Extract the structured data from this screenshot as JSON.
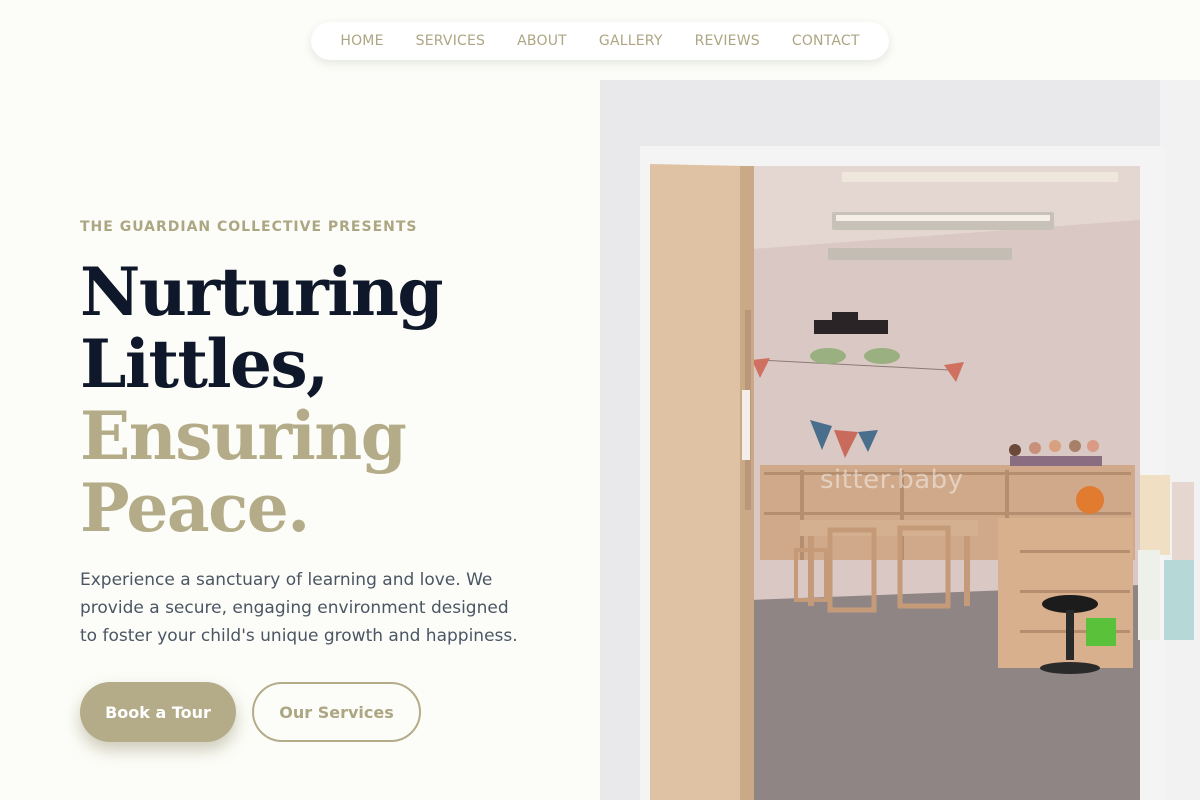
{
  "nav": {
    "items": [
      {
        "label": "HOME"
      },
      {
        "label": "SERVICES"
      },
      {
        "label": "ABOUT"
      },
      {
        "label": "GALLERY"
      },
      {
        "label": "REVIEWS"
      },
      {
        "label": "CONTACT"
      }
    ]
  },
  "hero": {
    "eyebrow": "THE GUARDIAN COLLECTIVE PRESENTS",
    "headline_line1": "Nurturing",
    "headline_line2": "Littles,",
    "headline_line3": "Ensuring",
    "headline_line4": "Peace.",
    "description": "Experience a sanctuary of learning and love. We provide a secure, engaging environment designed to foster your child's unique growth and happiness.",
    "primary_button": "Book a Tour",
    "secondary_button": "Our Services",
    "image_watermark": "sitter.baby"
  },
  "colors": {
    "background": "#fcfdf8",
    "accent": "#b4ac88",
    "heading_dark": "#0f172a",
    "body_text": "#4b5563"
  }
}
